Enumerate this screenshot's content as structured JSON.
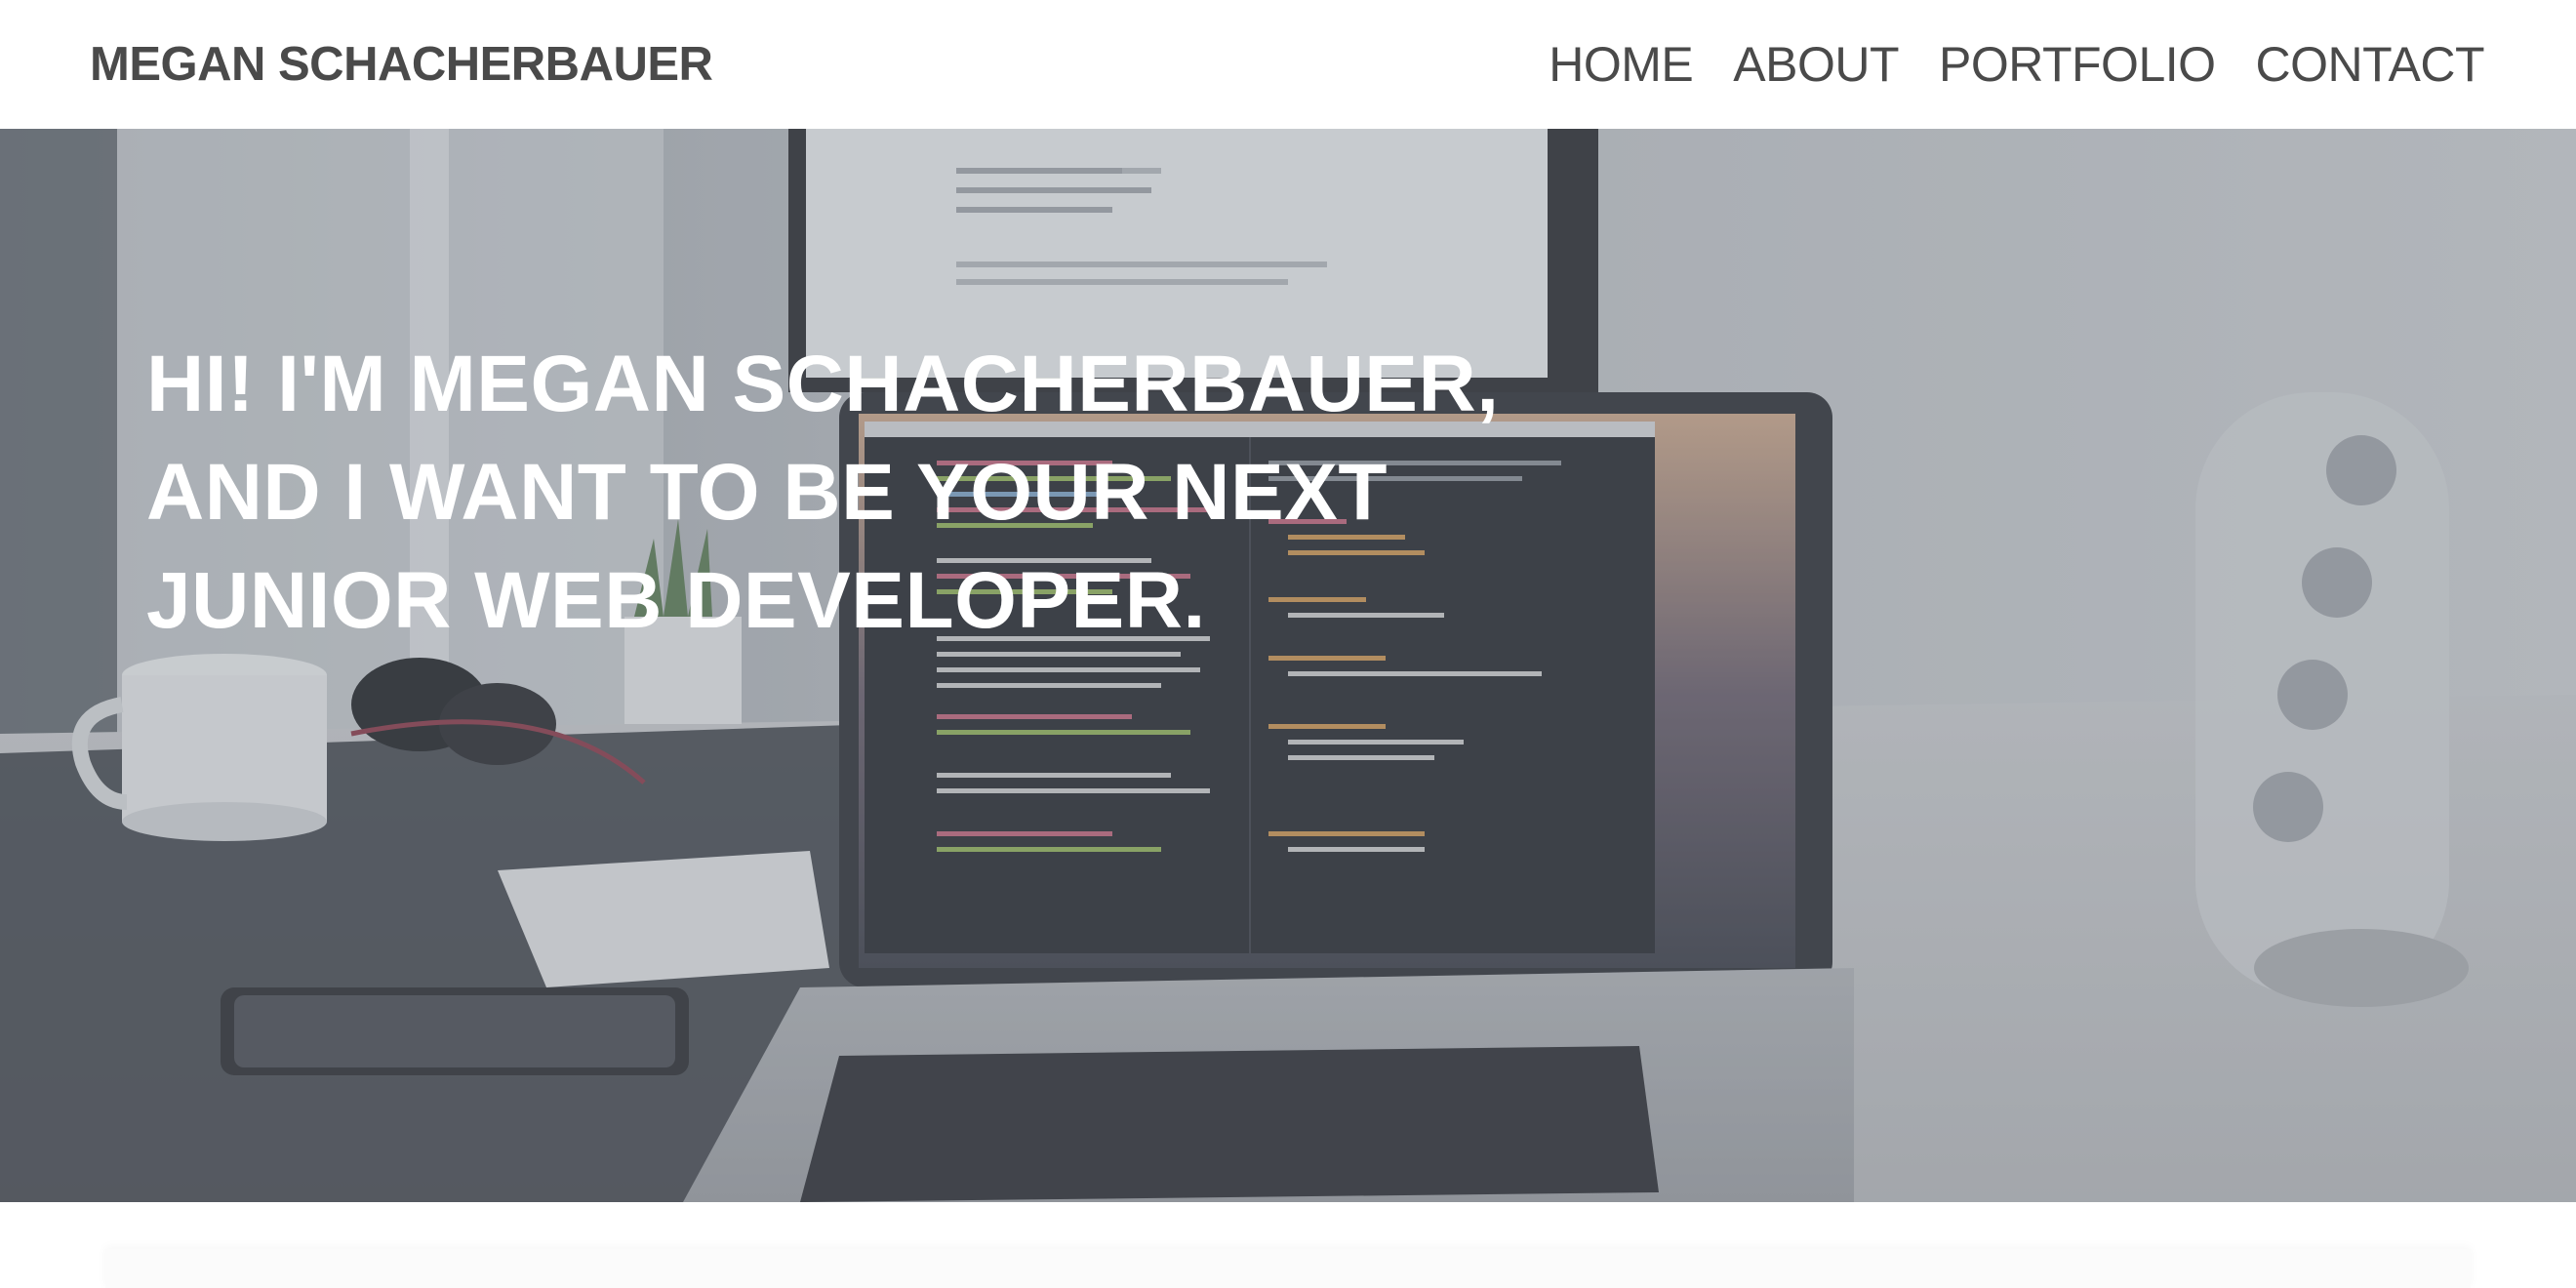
{
  "header": {
    "brand": "MEGAN SCHACHERBAUER",
    "nav": [
      {
        "label": "HOME"
      },
      {
        "label": "ABOUT"
      },
      {
        "label": "PORTFOLIO"
      },
      {
        "label": "CONTACT"
      }
    ]
  },
  "hero": {
    "heading_lines": [
      "HI! I'M MEGAN SCHACHERBAUER,",
      "AND I WANT TO BE YOUR NEXT",
      "JUNIOR WEB DEVELOPER."
    ],
    "background": "laptop-desk-photo",
    "overlay_color": "#787c84"
  },
  "colors": {
    "nav_text": "#4a4a4a",
    "hero_text": "#ffffff",
    "page_bg": "#ffffff"
  }
}
